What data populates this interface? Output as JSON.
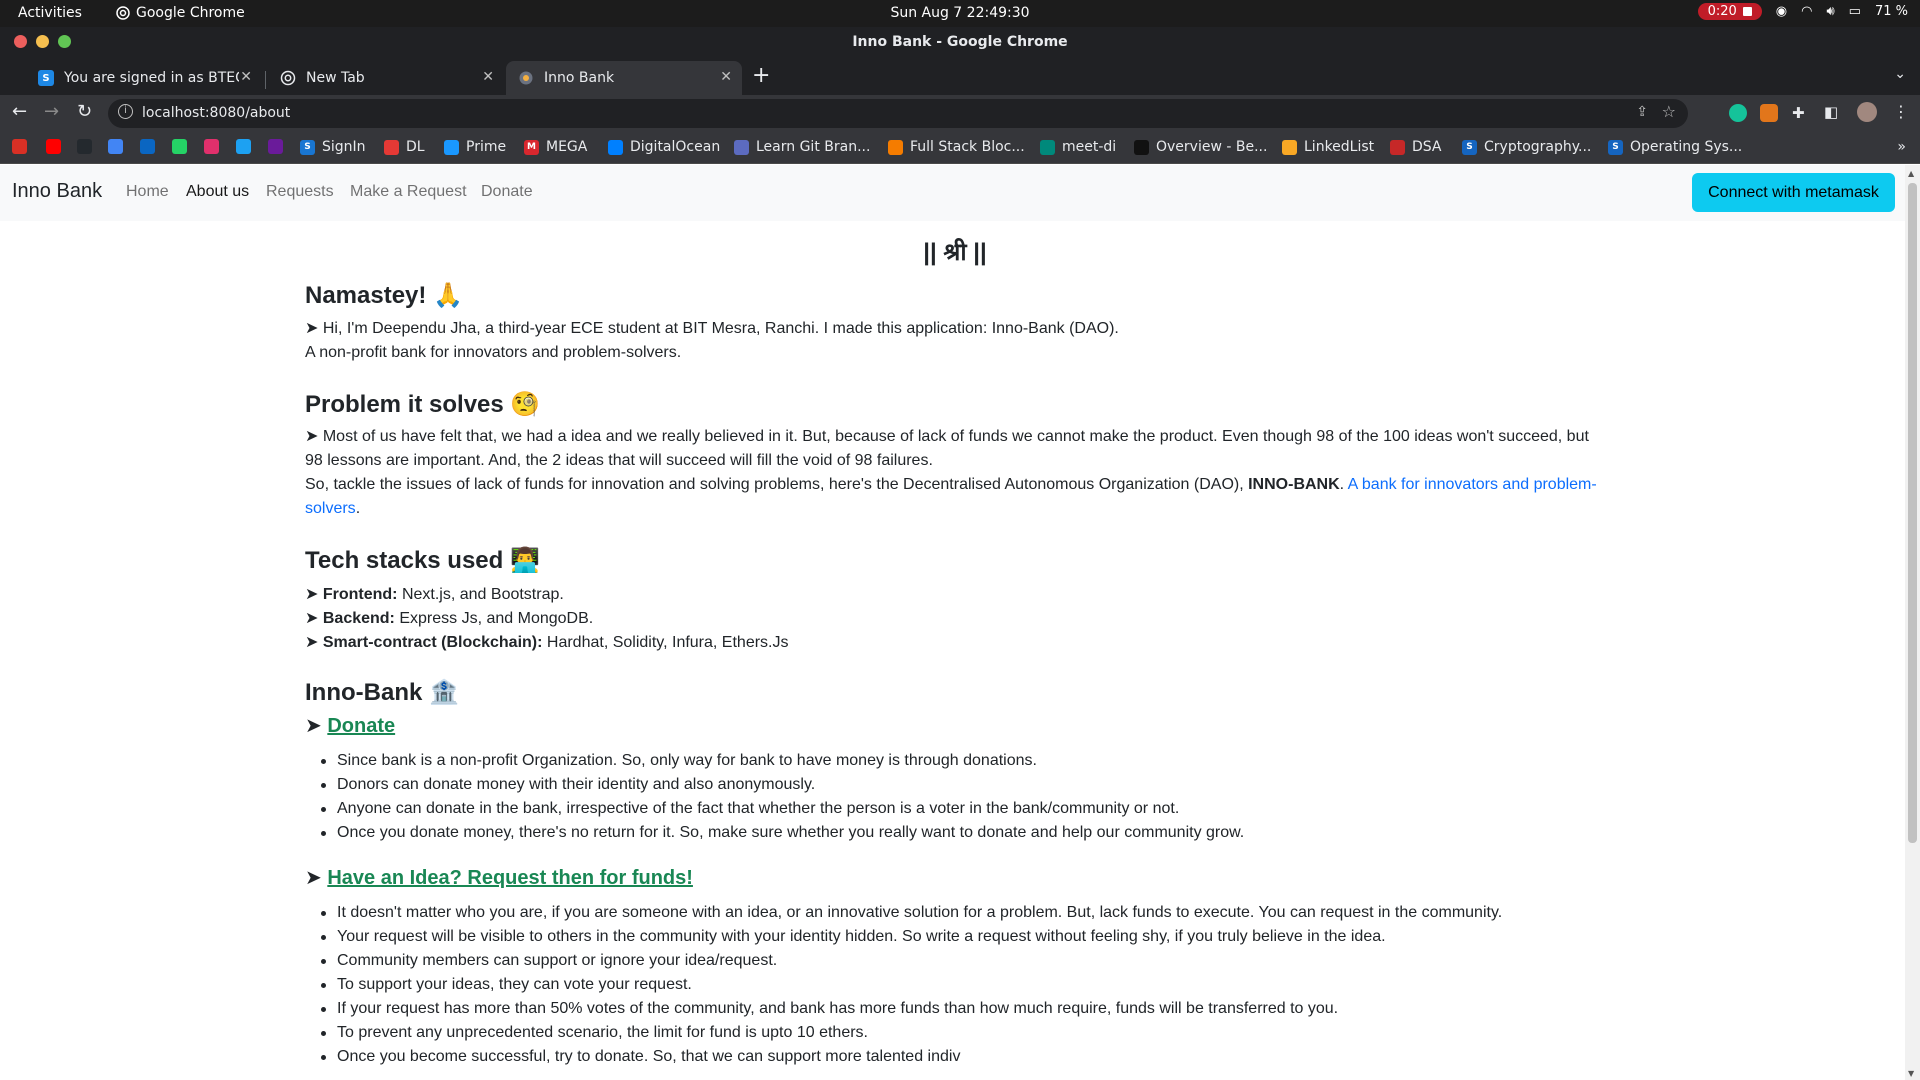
{
  "system": {
    "activities": "Activities",
    "app_name": "Google Chrome",
    "clock": "Sun Aug 7  22:49:30",
    "recording": "0:20",
    "battery": "71 %"
  },
  "window": {
    "title": "Inno Bank - Google Chrome"
  },
  "tabs": [
    {
      "label": "You are signed in as BTEC",
      "favicon": "S"
    },
    {
      "label": "New Tab",
      "favicon": "chrome-icon"
    },
    {
      "label": "Inno Bank",
      "favicon": "inno-icon"
    }
  ],
  "address": {
    "url": "localhost:8080/about"
  },
  "bookmarks": [
    {
      "label": "",
      "icon": "gmail-icon",
      "color": "#d93025"
    },
    {
      "label": "",
      "icon": "youtube-icon",
      "color": "#ff0000"
    },
    {
      "label": "",
      "icon": "github-icon",
      "color": "#24292e"
    },
    {
      "label": "",
      "icon": "docs-icon",
      "color": "#4285f4"
    },
    {
      "label": "",
      "icon": "linkedin-icon",
      "color": "#0a66c2"
    },
    {
      "label": "",
      "icon": "whatsapp-icon",
      "color": "#25d366"
    },
    {
      "label": "",
      "icon": "instagram-icon",
      "color": "#e1306c"
    },
    {
      "label": "",
      "icon": "twitter-icon",
      "color": "#1da1f2"
    },
    {
      "label": "",
      "icon": "unknown-icon",
      "color": "#6a1b9a"
    },
    {
      "label": "SignIn",
      "icon": "S",
      "color": "#1976d2"
    },
    {
      "label": "DL",
      "icon": "dl-icon",
      "color": "#e53935"
    },
    {
      "label": "Prime",
      "icon": "prime-icon",
      "color": "#1a98ff"
    },
    {
      "label": "MEGA",
      "icon": "M",
      "color": "#d9272e"
    },
    {
      "label": "DigitalOcean",
      "icon": "do-icon",
      "color": "#0080ff"
    },
    {
      "label": "Learn Git Bran...",
      "icon": "git-icon",
      "color": "#5c6bc0"
    },
    {
      "label": "Full Stack Bloc...",
      "icon": "fs-icon",
      "color": "#f57c00"
    },
    {
      "label": "meet-di",
      "icon": "meet-icon",
      "color": "#00897b"
    },
    {
      "label": "Overview - Be...",
      "icon": "vercel-icon",
      "color": "#111111"
    },
    {
      "label": "LinkedList",
      "icon": "ll-icon",
      "color": "#f9a825"
    },
    {
      "label": "DSA",
      "icon": "dsa-icon",
      "color": "#c62828"
    },
    {
      "label": "Cryptography...",
      "icon": "S",
      "color": "#1565c0"
    },
    {
      "label": "Operating Sys...",
      "icon": "S",
      "color": "#1565c0"
    }
  ],
  "navbar": {
    "brand": "Inno Bank",
    "links": [
      "Home",
      "About us",
      "Requests",
      "Make a Request",
      "Donate"
    ],
    "active": "About us",
    "cta": "Connect with metamask"
  },
  "content": {
    "shri": "|| श्री ||",
    "s1_title": "Namastey! 🙏",
    "s1_p1": "➤ Hi, I'm Deependu Jha, a third-year ECE student at BIT Mesra, Ranchi. I made this application: Inno-Bank (DAO).",
    "s1_p2": "A non-profit bank for innovators and problem-solvers.",
    "s2_title": "Problem it solves 🧐",
    "s2_p1": "➤ Most of us have felt that, we had a idea and we really believed in it. But, because of lack of funds we cannot make the product. Even though 98 of the 100 ideas won't succeed, but 98 lessons are important. And, the 2 ideas that will succeed will fill the void of 98 failures.",
    "s2_p2_pre": "So, tackle the issues of lack of funds for innovation and solving problems, here's the Decentralised Autonomous Organization (DAO), ",
    "s2_p2_bold": "INNO-BANK",
    "s2_p2_mid": ". ",
    "s2_p2_link": "A bank for innovators and problem-solvers",
    "s2_p2_end": ".",
    "s3_title": "Tech stacks used 👨‍💻",
    "s3_fe_label": "Frontend:",
    "s3_fe": " Next.js, and Bootstrap.",
    "s3_be_label": "Backend:",
    "s3_be": " Express Js, and MongoDB.",
    "s3_sc_label": "Smart-contract (Blockchain):",
    "s3_sc": " Hardhat, Solidity, Infura, Ethers.Js",
    "s4_title": "Inno-Bank 🏦",
    "donate_link": "Donate",
    "donate_items": [
      "Since bank is a non-profit Organization. So, only way for bank to have money is through donations.",
      "Donors can donate money with their identity and also anonymously.",
      "Anyone can donate in the bank, irrespective of the fact that whether the person is a voter in the bank/community or not.",
      "Once you donate money, there's no return for it. So, make sure whether you really want to donate and help our community grow."
    ],
    "idea_link": "Have an Idea? Request then for funds!",
    "idea_items": [
      "It doesn't matter who you are, if you are someone with an idea, or an innovative solution for a problem. But, lack funds to execute. You can request in the community.",
      "Your request will be visible to others in the community with your identity hidden. So write a request without feeling shy, if you truly believe in the idea.",
      "Community members can support or ignore your idea/request.",
      "To support your ideas, they can vote your request.",
      "If your request has more than 50% votes of the community, and bank has more funds than how much require, funds will be transferred to you.",
      "To prevent any unprecedented scenario, the limit for fund is upto 10 ethers.",
      "Once you become successful, try to donate. So, that we can support more talented indiv"
    ]
  }
}
